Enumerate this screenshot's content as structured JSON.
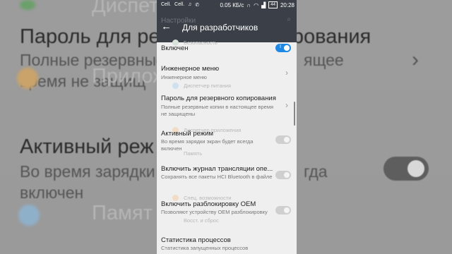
{
  "background": {
    "line1": "Диспет",
    "line2": "Пароль для резервного копирования",
    "line3": "Полные резервные",
    "line3b": "ящее",
    "line4": "время не защищ",
    "line5": "Приложе",
    "line6": "Активный реж",
    "line7": "Во время зарядки",
    "line7b": "гда",
    "line8": "включен",
    "line9": "Памят"
  },
  "statusbar": {
    "carrier1": "Cell.",
    "carrier2": "Cell.",
    "speed": "0.05 КБ/с",
    "battery": "44",
    "time": "20:28"
  },
  "appbar": {
    "ghost_title": "Настройки",
    "title": "Для разработчиков"
  },
  "settings": {
    "enabled_label": "Включен",
    "engineering_title": "Инженерное меню",
    "engineering_sub": "Инженерное меню",
    "backup_title": "Пароль для резервного копирования",
    "backup_sub": "Полные резервные копии в настоящее время не защищены",
    "awake_title": "Активный режим",
    "awake_sub": "Во время зарядки экран будет всегда включен",
    "hci_title": "Включить журнал трансляции опе...",
    "hci_sub": "Сохранять все пакеты HCI Bluetooth в файле",
    "oem_title": "Включить разблокировку OEM",
    "oem_sub": "Позволяют устройству OEM разблокировку",
    "stats_title": "Статистика процессов",
    "stats_sub": "Статистика запущенных процессов"
  },
  "ghosts": {
    "security": "Безопасность",
    "battery": "Диспетчер питания",
    "apps": "Диспетчер приложения",
    "memory": "Память",
    "accessibility": "Спец. возможности",
    "backup": "Восст. и сброс"
  }
}
